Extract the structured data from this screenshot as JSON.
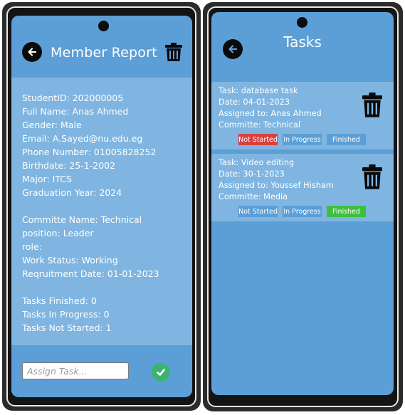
{
  "member_report": {
    "title": "Member Report",
    "info_lines": [
      "StudentID: 202000005",
      "Full Name: Anas Ahmed",
      "Gender: Male",
      "Email: A.Sayed@nu.edu.eg",
      "Phone Number: 01005828252",
      "Birthdate: 25-1-2002",
      "Major: ITCS",
      "Graduation Year: 2024"
    ],
    "committee_lines": [
      "Committe Name: Technical",
      "position: Leader",
      "role:",
      "Work Status: Working",
      "Reqruitment Date: 01-01-2023"
    ],
    "task_stats": [
      "Tasks Finished: 0",
      "Tasks In Progress: 0",
      "Tasks Not Started: 1"
    ],
    "assign_placeholder": "Assign Task...",
    "colors": {
      "confirm": "#3cb371",
      "panel": "#7fb5e0",
      "screen": "#5b9fd6"
    },
    "icons": {
      "back": "arrow-left-icon",
      "delete": "trash-icon",
      "confirm": "check-circle-icon"
    }
  },
  "tasks_screen": {
    "title": "Tasks",
    "tasks": [
      {
        "task": "Task: database task",
        "date": "Date: 04-01-2023",
        "assigned": "Assigned to: Anas Ahmed",
        "committee": "Committe: Technical",
        "status": "Not Started"
      },
      {
        "task": "Task: Video editing",
        "date": "Date: 30-1-2023",
        "assigned": "Assigned to: Youssef Hisham",
        "committee": "Committe: Media",
        "status": "Finished"
      }
    ],
    "status_labels": {
      "not_started": "Not Started",
      "in_progress": "In Progress",
      "finished": "Finished"
    },
    "colors": {
      "not_started_active": "#d94141",
      "finished_active": "#3dc13d"
    }
  }
}
